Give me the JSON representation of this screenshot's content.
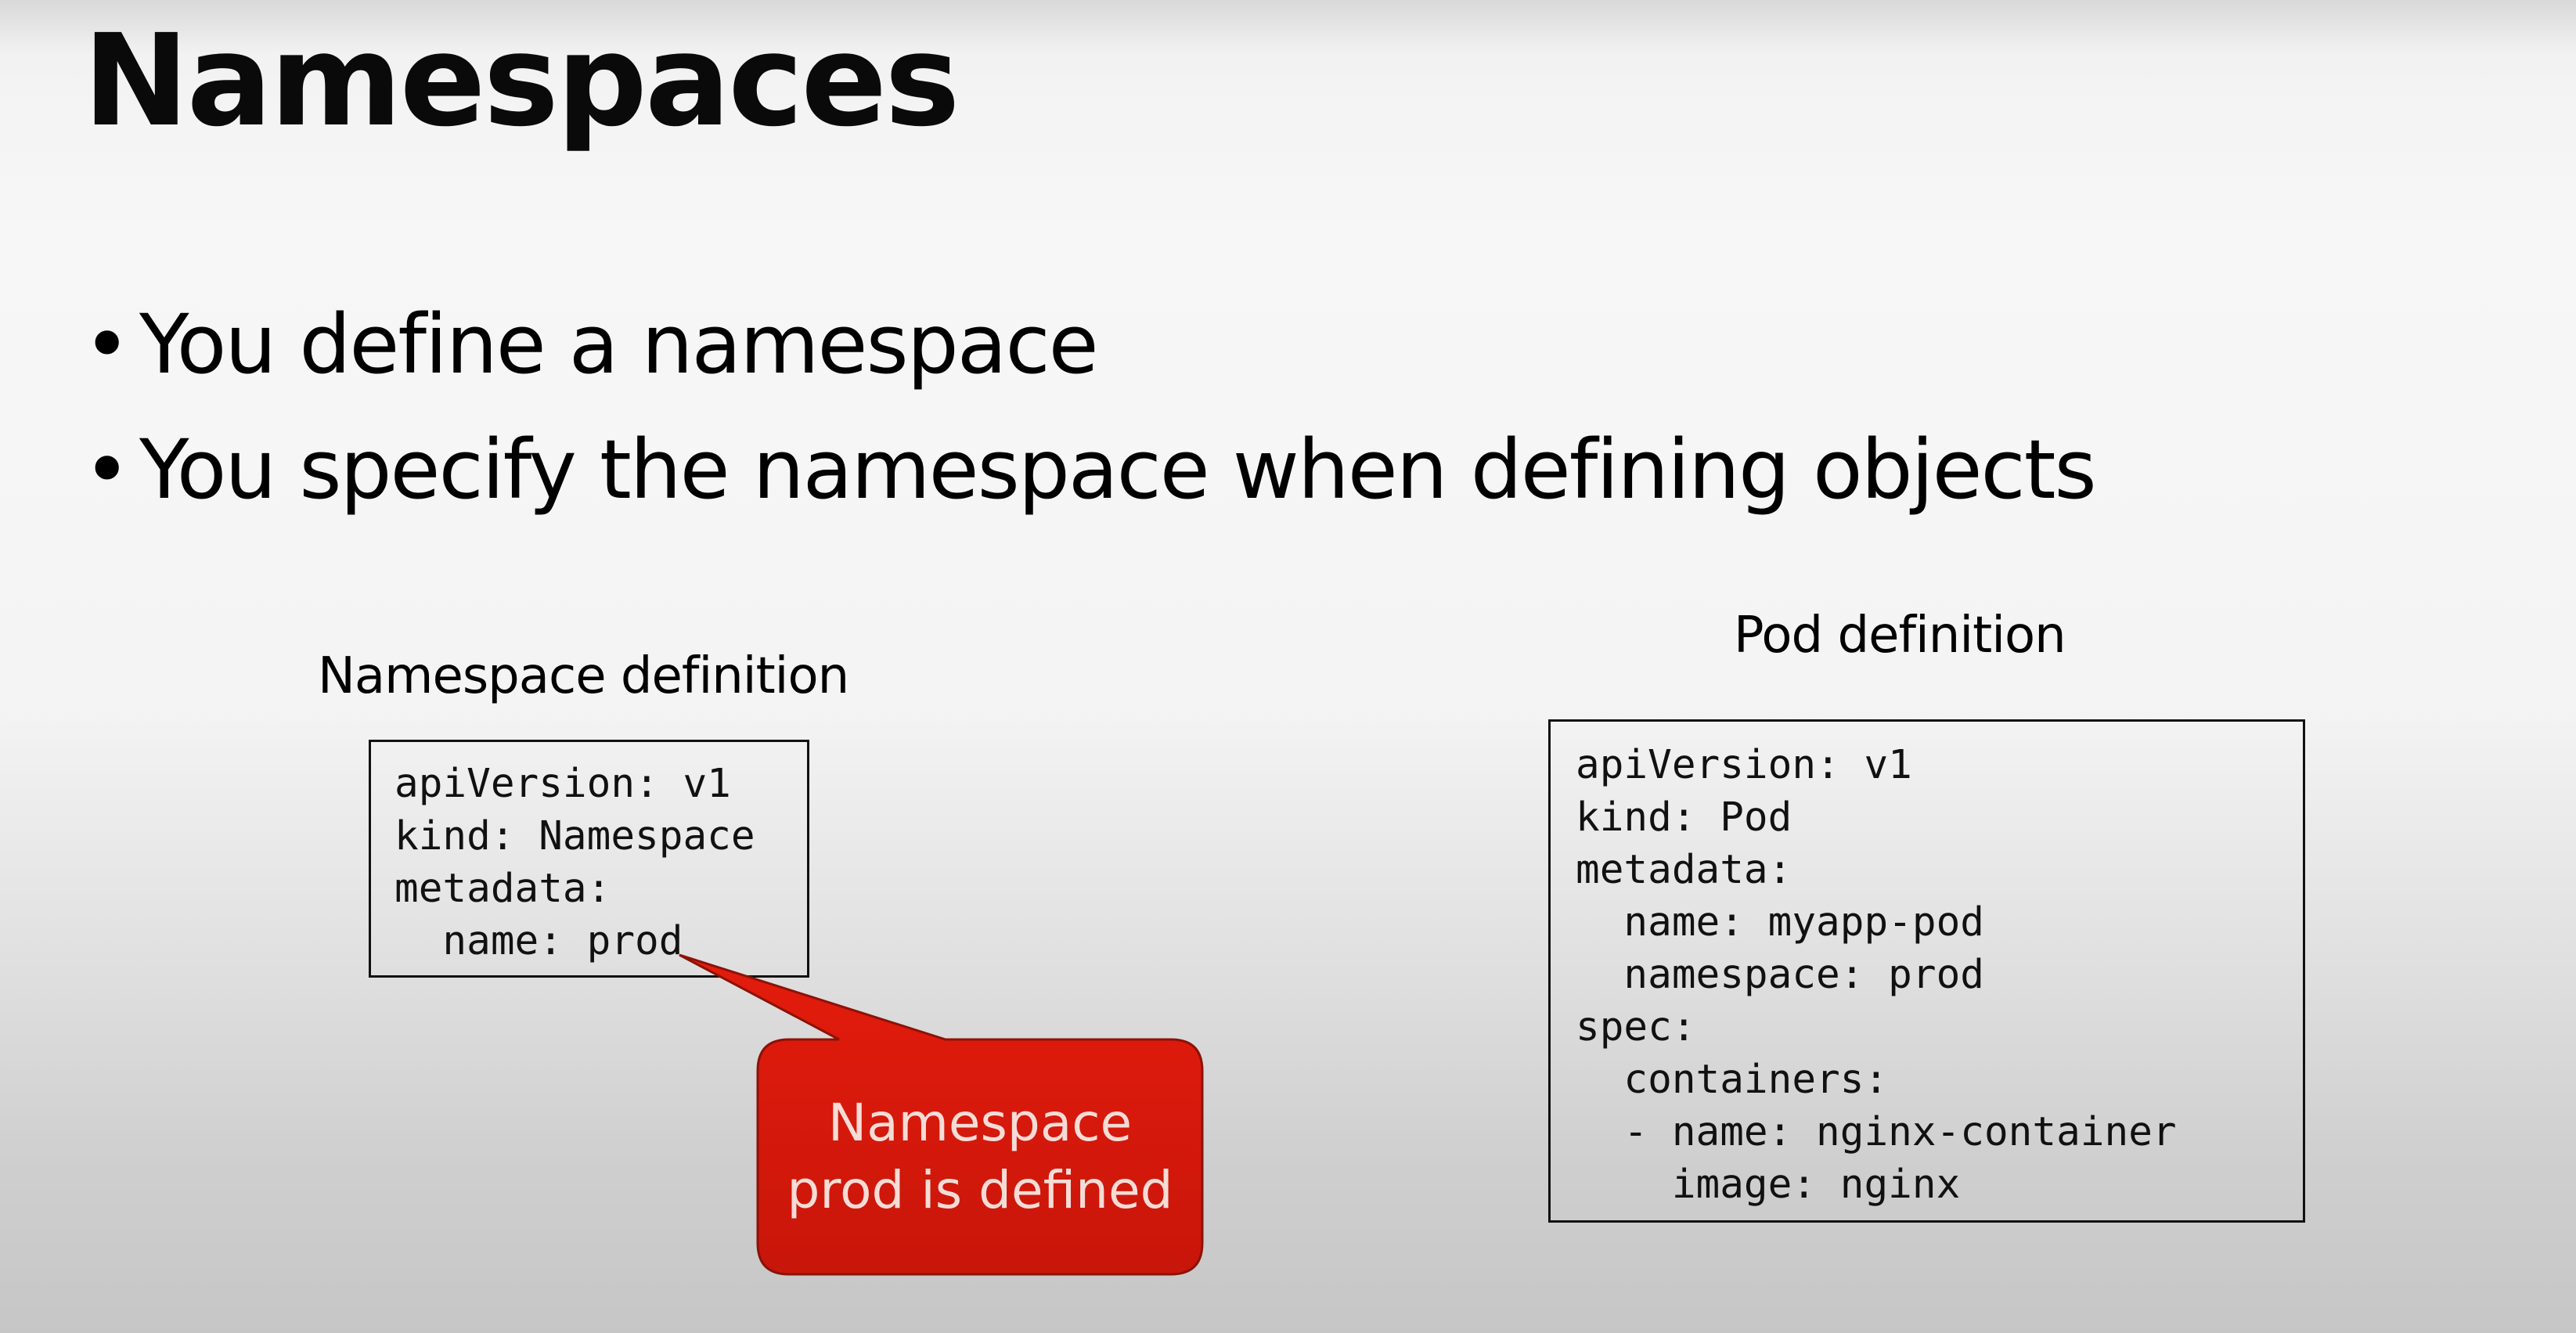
{
  "slide": {
    "title": "Namespaces",
    "bullets": [
      "You define a namespace",
      "You specify the namespace when defining objects"
    ]
  },
  "namespace_definition": {
    "caption": "Namespace definition",
    "lines": [
      "apiVersion: v1",
      "kind: Namespace",
      "metadata:",
      "  name: prod"
    ]
  },
  "pod_definition": {
    "caption": "Pod definition",
    "lines": [
      "apiVersion: v1",
      "kind: Pod",
      "metadata:",
      "  name: myapp-pod",
      "  namespace: prod",
      "spec:",
      "  containers:",
      "  - name: nginx-container",
      "    image: nginx"
    ]
  },
  "callout": {
    "line1": "Namespace",
    "line2": "prod is defined",
    "color": "#d81a0c"
  }
}
